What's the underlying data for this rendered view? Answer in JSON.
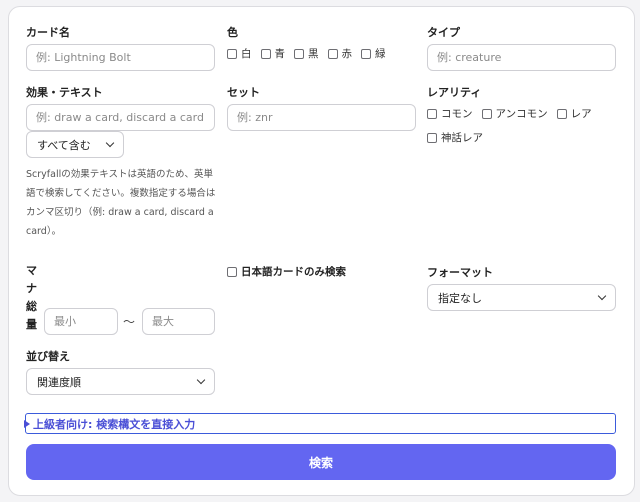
{
  "card_name": {
    "label": "カード名",
    "placeholder": "例: Lightning Bolt"
  },
  "color": {
    "label": "色",
    "options": [
      "白",
      "青",
      "黒",
      "赤",
      "緑"
    ]
  },
  "type": {
    "label": "タイプ",
    "placeholder": "例: creature"
  },
  "effect": {
    "label": "効果・テキスト",
    "placeholder": "例: draw a card, discard a card",
    "match_mode": "すべて含む",
    "help": "Scryfallの効果テキストは英語のため、英単語で検索してください。複数指定する場合はカンマ区切り（例: draw a card, discard a card）。"
  },
  "set": {
    "label": "セット",
    "placeholder": "例: znr"
  },
  "rarity": {
    "label": "レアリティ",
    "options": [
      "コモン",
      "アンコモン",
      "レア",
      "神話レア"
    ]
  },
  "mana": {
    "label_chars": [
      "マ",
      "ナ",
      "総",
      "量"
    ],
    "min_placeholder": "最小",
    "separator": "〜",
    "max_placeholder": "最大"
  },
  "japanese_only": {
    "label": "日本語カードのみ検索"
  },
  "format": {
    "label": "フォーマット",
    "selected": "指定なし"
  },
  "sort": {
    "label": "並び替え",
    "selected": "関連度順"
  },
  "advanced": {
    "label": "上級者向け: 検索構文を直接入力"
  },
  "search_button": {
    "label": "検索"
  },
  "colors": {
    "accent": "#6366f1",
    "link": "#4a4fd6",
    "border": "#cfcfd4"
  }
}
